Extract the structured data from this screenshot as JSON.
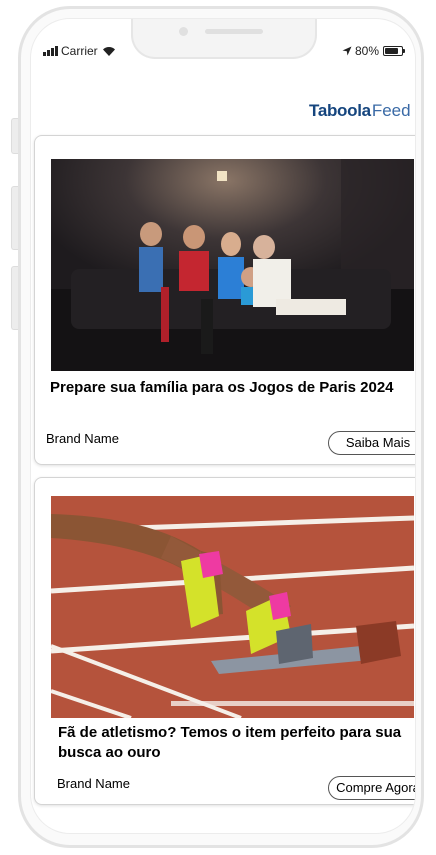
{
  "status_bar": {
    "carrier": "Carrier",
    "battery": "80%",
    "icons": [
      "signal-bars-icon",
      "wifi-icon",
      "location-arrow-icon",
      "battery-icon"
    ]
  },
  "header": {
    "logo_main": "Taboola",
    "logo_sub": "Feed"
  },
  "feed": [
    {
      "title": "Prepare sua família para os Jogos de Paris 2024",
      "brand": "Brand Name",
      "cta": "Saiba Mais"
    },
    {
      "title": "Fã de atletismo? Temos o item perfeito para sua busca ao ouro",
      "brand": "Brand Name",
      "cta": "Compre Agora"
    }
  ],
  "colors": {
    "logo": "#15457e",
    "track": "#b5533c",
    "shoe": "#d4e22a"
  }
}
